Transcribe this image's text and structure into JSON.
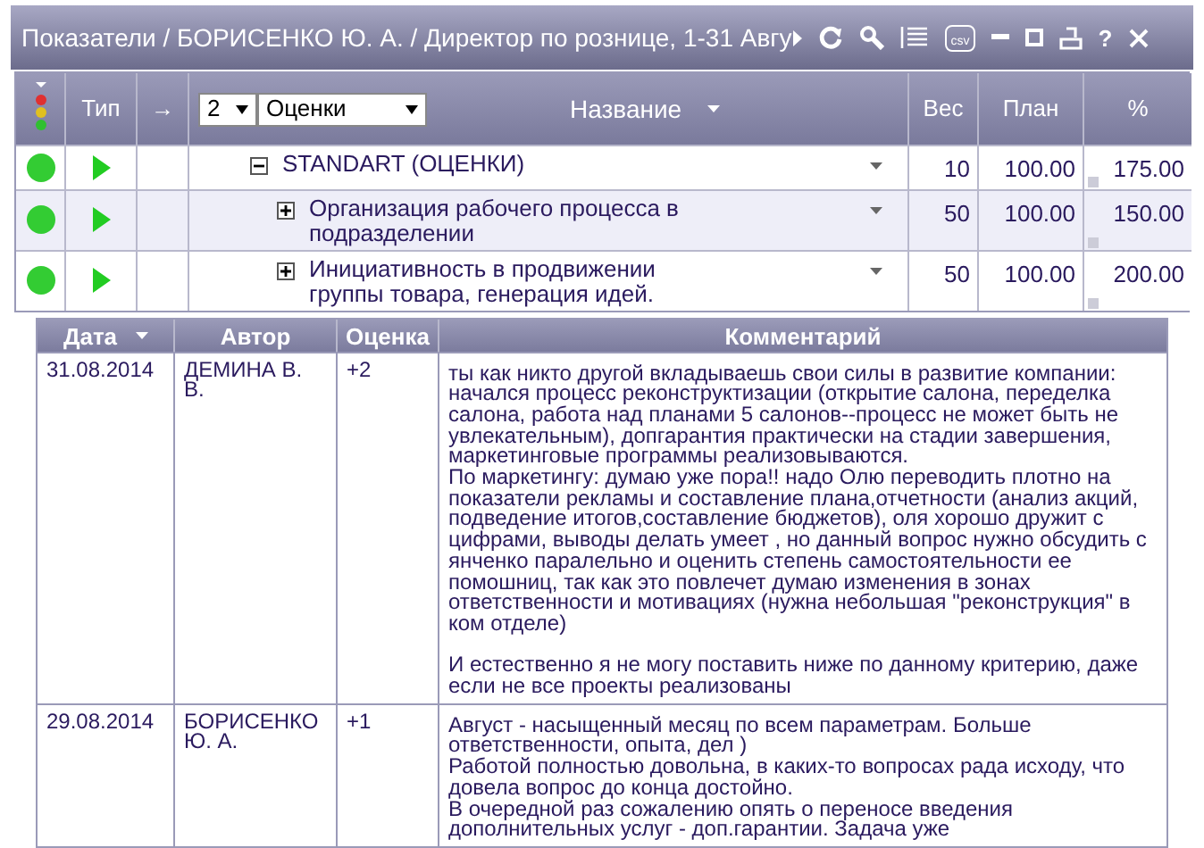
{
  "window": {
    "title": "Показатели / БОРИСЕНКО Ю. А. / Директор по рознице, 1-31 Авгу",
    "toolbar": [
      {
        "kind": "refresh"
      },
      {
        "kind": "search"
      },
      {
        "kind": "list"
      },
      {
        "kind": "csv",
        "label": "csv"
      },
      {
        "kind": "minimize"
      },
      {
        "kind": "maximize"
      },
      {
        "kind": "print"
      },
      {
        "kind": "help",
        "label": "?"
      },
      {
        "kind": "close"
      }
    ]
  },
  "indicators": {
    "columns": {
      "type": "Тип",
      "arrow": "→",
      "level_select": "2",
      "view_select": "Оценки",
      "name": "Название",
      "weight": "Вес",
      "plan": "План",
      "percent": "%"
    },
    "rows": [
      {
        "color": "#33cc33",
        "name": "STANDART (ОЦЕНКИ)",
        "expanded": true,
        "weight": "10",
        "plan": "100.00",
        "percent": "175.00",
        "children": [
          {
            "color": "#33cc33",
            "name": "Организация рабочего процесса в подразделении",
            "expanded": false,
            "weight": "50",
            "plan": "100.00",
            "percent": "150.00"
          },
          {
            "color": "#33cc33",
            "name": "Инициативность в продвижении группы товара, генерация идей.",
            "expanded": false,
            "weight": "50",
            "plan": "100.00",
            "percent": "200.00"
          }
        ]
      }
    ]
  },
  "comments": {
    "columns": [
      "Дата",
      "Автор",
      "Оценка",
      "Комментарий"
    ],
    "rows": [
      {
        "date": "31.08.2014",
        "author": "ДЕМИНА В. В.",
        "score": "+2",
        "comment": "ты как никто другой вкладываешь свои силы в развитие компании: начался процесс реконструктизации (открытие салона, переделка салона, работа над планами 5 салонов--процесс не может быть не увлекательным), допгарантия практически на стадии завершения, маркетинговые программы реализовываются.\nПо маркетингу: думаю уже пора!! надо Олю переводить плотно на показатели рекламы и составление плана,отчетности (анализ акций, подведение итогов,составление бюджетов), оля хорошо дружит с цифрами, выводы делать умеет , но данный вопрос нужно обсудить с янченко паралельно и оценить степень самостоятельности ее помошниц, так как это повлечет думаю изменения в зонах ответственности и мотивациях (нужна небольшая \"реконструкция\"  в ком отделе)\n\nИ естественно я не могу поставить ниже по данному критерию, даже если не все проекты реализованы"
      },
      {
        "date": "29.08.2014",
        "author": "БОРИСЕНКО Ю. А.",
        "score": "+1",
        "comment": "Август  - насыщенный месяц по всем параметрам. Больше ответственности, опыта, дел )\nРаботой полностью довольна, в каких-то вопросах рада исходу, что довела вопрос до конца достойно.\nВ очередной раз сожалению опять о переносе введения дополнительных услуг - доп.гарантии. Задача уже"
      }
    ]
  }
}
